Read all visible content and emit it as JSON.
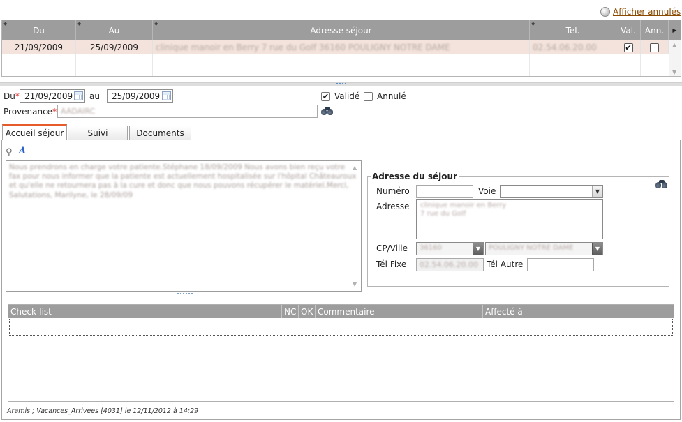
{
  "top_link": {
    "label": "Afficher annulés"
  },
  "stays_grid": {
    "columns": [
      "Du",
      "Au",
      "Adresse séjour",
      "Tel.",
      "Val.",
      "Ann."
    ],
    "rows": [
      {
        "du": "21/09/2009",
        "au": "25/09/2009",
        "adresse": "clinique manoir en Berry 7 rue du Golf 36160 POULIGNY NOTRE DAME",
        "tel": "02.54.06.20.00",
        "val": true,
        "ann": false
      }
    ]
  },
  "dates": {
    "du_label": "Du",
    "du_value": "21/09/2009",
    "au_label": "au",
    "au_value": "25/09/2009",
    "valide_label": "Validé",
    "valide_checked": true,
    "annule_label": "Annulé",
    "annule_checked": false
  },
  "provenance": {
    "label": "Provenance",
    "value": "AADAIRC"
  },
  "tabs": [
    {
      "label": "Accueil séjour",
      "active": true
    },
    {
      "label": "Suivi",
      "active": false
    },
    {
      "label": "Documents",
      "active": false
    }
  ],
  "memo": {
    "text": "Nous prendrons en charge votre patiente.Stéphane 18/09/2009 Nous avons bien reçu votre fax pour nous informer que la patiente est actuellement hospitalisée sur l'hôpital Châteauroux et qu'elle ne retournera pas à la cure et donc que nous pouvons récupérer le matériel.Merci, Salutations, Marilyne, le 28/09/09"
  },
  "address": {
    "legend": "Adresse du séjour",
    "numero_label": "Numéro",
    "numero_value": "",
    "voie_label": "Voie",
    "voie_value": "",
    "adresse_label": "Adresse",
    "adresse_line1": "clinique manoir en Berry",
    "adresse_line2": "7 rue du Golf",
    "cpville_label": "CP/Ville",
    "cp_value": "36160",
    "ville_value": "POULIGNY NOTRE DAME",
    "tel_fixe_label": "Tél Fixe",
    "tel_fixe_value": "02.54.06.20.00",
    "tel_autre_label": "Tél Autre",
    "tel_autre_value": ""
  },
  "checklist": {
    "columns": [
      "Check-list",
      "NC",
      "OK",
      "Commentaire",
      "Affecté à"
    ]
  },
  "footer": {
    "note": "Aramis ; Vacances_Arrivees [4031] le 12/11/2012 à 14:29"
  },
  "colors": {
    "header_gray": "#9d9d9d",
    "selected_row": "#f3e3dc",
    "tab_accent": "#e55b2b",
    "link": "#8a4a00"
  }
}
